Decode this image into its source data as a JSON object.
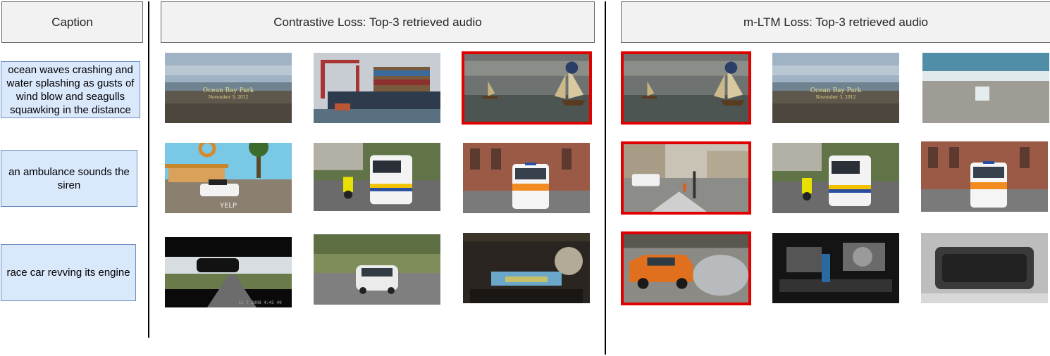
{
  "headers": {
    "caption": "Caption",
    "contrastive": "Contrastive Loss: Top-3 retrieved audio",
    "mltm": "m-LTM Loss: Top-3 retrieved audio"
  },
  "captions": [
    "ocean waves crashing and water splashing as gusts of wind blow and seagulls squawking in the distance",
    "an ambulance sounds the siren",
    "race car revving its engine"
  ],
  "retrievals": {
    "contrastive": [
      [
        {
          "scene": "beach-ocean-bay-park",
          "overlay": "Ocean Bay Park",
          "overlay_sub": "November 3, 2012",
          "correct": false
        },
        {
          "scene": "container-ship-port",
          "correct": false
        },
        {
          "scene": "sailing-ships-sea",
          "correct": true
        }
      ],
      [
        {
          "scene": "game-police-car-gas-station",
          "overlay": "YELP",
          "correct": false
        },
        {
          "scene": "police-van-motorcycle",
          "correct": false
        },
        {
          "scene": "ambulance-street",
          "correct": false
        }
      ],
      [
        {
          "scene": "in-car-road-view",
          "overlay": "11 7 2008   4:45 49",
          "correct": false
        },
        {
          "scene": "white-car-rally",
          "correct": false
        },
        {
          "scene": "rally-cockpit",
          "correct": false
        }
      ]
    ],
    "mltm": [
      [
        {
          "scene": "sailing-ships-sea",
          "correct": true
        },
        {
          "scene": "beach-ocean-bay-park",
          "overlay": "Ocean Bay Park",
          "overlay_sub": "November 3, 2012",
          "correct": false
        },
        {
          "scene": "waves-on-shore",
          "correct": false
        }
      ],
      [
        {
          "scene": "city-square-ambulance",
          "correct": true
        },
        {
          "scene": "police-van-motorcycle",
          "correct": false
        },
        {
          "scene": "ambulance-street",
          "correct": false
        }
      ],
      [
        {
          "scene": "orange-car-burnout",
          "correct": true
        },
        {
          "scene": "engine-bay-turbo",
          "correct": false
        },
        {
          "scene": "engine-bay-cover",
          "correct": false
        }
      ]
    ]
  },
  "colors": {
    "correct_border": "#e00000",
    "caption_fill": "#dae8fc",
    "caption_border": "#6c8ebf",
    "header_fill": "#f2f2f2"
  }
}
